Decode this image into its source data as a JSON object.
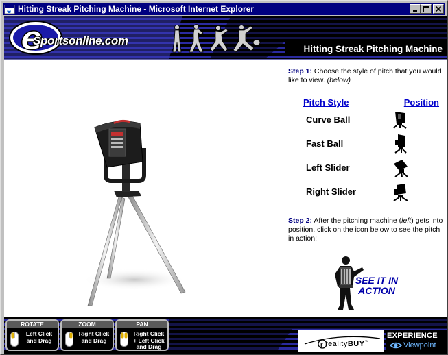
{
  "window": {
    "title": "Hitting Streak Pitching Machine - Microsoft Internet Explorer",
    "minimize": "_",
    "maximize": "□",
    "close": "×"
  },
  "banner": {
    "logo_text": "Sportsonline.com",
    "page_title": "Hitting Streak Pitching Machine"
  },
  "panel": {
    "step1_label": "Step 1:",
    "step1_text": " Choose the style of pitch that you would like to view. ",
    "step1_hint": "(below)",
    "col_pitch": "Pitch Style",
    "col_position": "Position",
    "pitches": [
      {
        "name": "Curve Ball",
        "icon": "curve-ball-position-icon"
      },
      {
        "name": "Fast Ball",
        "icon": "fast-ball-position-icon"
      },
      {
        "name": "Left Slider",
        "icon": "left-slider-position-icon"
      },
      {
        "name": "Right Slider",
        "icon": "right-slider-position-icon"
      }
    ],
    "step2_label": "Step 2:",
    "step2_text_a": " After the pitching machine (",
    "step2_left": "left",
    "step2_text_b": ") gets into position, click on the icon below to see the pitch in action!",
    "see_action_1": "SEE IT IN",
    "see_action_2": "ACTION"
  },
  "controls": [
    {
      "title": "ROTATE",
      "line1": "Left Click",
      "line2": "and Drag",
      "line3": ""
    },
    {
      "title": "ZOOM",
      "line1": "Right Click",
      "line2": "and Drag",
      "line3": ""
    },
    {
      "title": "PAN",
      "line1": "Right Click",
      "line2": "+ Left Click",
      "line3": "and Drag"
    }
  ],
  "footer": {
    "reality_buy_a": "reality",
    "reality_buy_b": "BUY",
    "reality_tm": "™",
    "experience": "EXPERIENCE",
    "viewpoint": "Viewpoint"
  },
  "colors": {
    "title_bar": "#000080",
    "link": "#0000cc",
    "step_label": "#000080"
  }
}
